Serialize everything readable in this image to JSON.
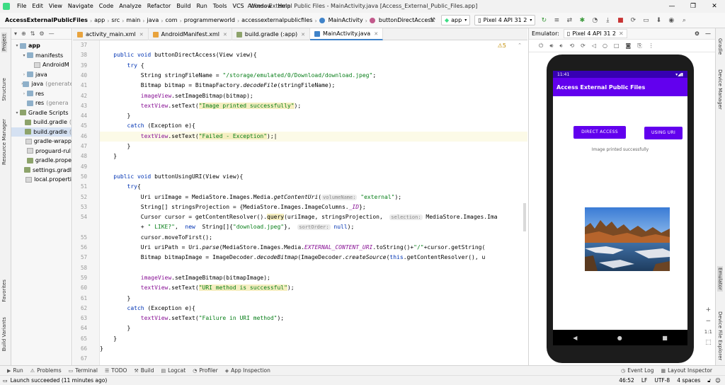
{
  "window": {
    "title": "Access External Public Files - MainActivity.java [Access_External_Public_Files.app]"
  },
  "menu": [
    "File",
    "Edit",
    "View",
    "Navigate",
    "Code",
    "Analyze",
    "Refactor",
    "Build",
    "Run",
    "Tools",
    "VCS",
    "Window",
    "Help"
  ],
  "breadcrumbs": [
    "AccessExternalPublicFiles",
    "app",
    "src",
    "main",
    "java",
    "com",
    "programmerworld",
    "accessexternalpublicfiles",
    "MainActivity",
    "buttonDirectAccess"
  ],
  "toolbar": {
    "config": "app",
    "device": "Pixel 4 API 31 2"
  },
  "left_tabs": [
    "Project",
    "Structure",
    "Resource Manager",
    "Favorites",
    "Build Variants"
  ],
  "right_tabs": [
    "Gradle",
    "Device Manager",
    "Emulator",
    "Device File Explorer"
  ],
  "project_tree": [
    {
      "label": "app",
      "level": 0,
      "arrow": "▾",
      "icon": "folder",
      "bold": true
    },
    {
      "label": "manifests",
      "level": 1,
      "arrow": "▾",
      "icon": "folder"
    },
    {
      "label": "AndroidM",
      "level": 2,
      "arrow": "",
      "icon": "file"
    },
    {
      "label": "java",
      "level": 1,
      "arrow": "›",
      "icon": "folder"
    },
    {
      "label": "java",
      "suffix": "(generate",
      "level": 1,
      "arrow": "›",
      "icon": "folder"
    },
    {
      "label": "res",
      "level": 1,
      "arrow": "›",
      "icon": "folder"
    },
    {
      "label": "res",
      "suffix": "(genera",
      "level": 1,
      "arrow": "",
      "icon": "folder"
    },
    {
      "label": "Gradle Scripts",
      "level": 0,
      "arrow": "▾",
      "icon": "gradle"
    },
    {
      "label": "build.gradle",
      "suffix": "(",
      "level": 1,
      "arrow": "",
      "icon": "gradle"
    },
    {
      "label": "build.gradle",
      "suffix": "(",
      "level": 1,
      "arrow": "",
      "icon": "gradle",
      "selected": true
    },
    {
      "label": "gradle-wrapp",
      "level": 1,
      "arrow": "",
      "icon": "file"
    },
    {
      "label": "proguard-rul",
      "level": 1,
      "arrow": "",
      "icon": "file"
    },
    {
      "label": "gradle.prope",
      "level": 1,
      "arrow": "",
      "icon": "gradle"
    },
    {
      "label": "settings.gradl",
      "level": 1,
      "arrow": "",
      "icon": "gradle"
    },
    {
      "label": "local.properti",
      "level": 1,
      "arrow": "",
      "icon": "file"
    }
  ],
  "tabs": [
    {
      "label": "activity_main.xml",
      "color": "#e8a33d"
    },
    {
      "label": "AndroidManifest.xml",
      "color": "#e8a33d"
    },
    {
      "label": "build.gradle (:app)",
      "color": "#8da36b"
    },
    {
      "label": "MainActivity.java",
      "color": "#4083c9",
      "active": true
    }
  ],
  "editor": {
    "warnings": "⚠5",
    "line_numbers": [
      "37",
      "38",
      "39",
      "40",
      "41",
      "42",
      "43",
      "44",
      "45",
      "46",
      "47",
      "48",
      "49",
      "50",
      "51",
      "52",
      "53",
      "54",
      "",
      "55",
      "56",
      "57",
      "58",
      "59",
      "60",
      "61",
      "62",
      "63",
      "64",
      "65",
      "66",
      "67"
    ],
    "lines": [
      [],
      [
        {
          "t": "    "
        },
        {
          "t": "public void ",
          "c": "kw"
        },
        {
          "t": "buttonDirectAccess(View view){"
        }
      ],
      [
        {
          "t": "        "
        },
        {
          "t": "try ",
          "c": "kw"
        },
        {
          "t": "{"
        }
      ],
      [
        {
          "t": "            String stringFileName = "
        },
        {
          "t": "\"/storage/emulated/0/Download/download.jpeg\"",
          "c": "str"
        },
        {
          "t": ";"
        }
      ],
      [
        {
          "t": "            Bitmap bitmap = BitmapFactory."
        },
        {
          "t": "decodeFile",
          "c": "it"
        },
        {
          "t": "(stringFileName);"
        }
      ],
      [
        {
          "t": "            "
        },
        {
          "t": "imageView",
          "c": "fld"
        },
        {
          "t": ".setImageBitmap(bitmap);"
        }
      ],
      [
        {
          "t": "            "
        },
        {
          "t": "textView",
          "c": "fld"
        },
        {
          "t": ".setText("
        },
        {
          "t": "\"Image printed successfully\"",
          "c": "str hl"
        },
        {
          "t": ");"
        }
      ],
      [
        {
          "t": "        }"
        }
      ],
      [
        {
          "t": "        "
        },
        {
          "t": "catch ",
          "c": "kw"
        },
        {
          "t": "(Exception e){"
        }
      ],
      [
        {
          "t": "            "
        },
        {
          "t": "textView",
          "c": "fld"
        },
        {
          "t": ".setText("
        },
        {
          "t": "\"Failed - Exception\"",
          "c": "str hl"
        },
        {
          "t": ");|"
        }
      ],
      [
        {
          "t": "        }"
        }
      ],
      [
        {
          "t": "    }"
        }
      ],
      [],
      [
        {
          "t": "    "
        },
        {
          "t": "public void ",
          "c": "kw"
        },
        {
          "t": "buttonUsingURI(View view){"
        }
      ],
      [
        {
          "t": "        "
        },
        {
          "t": "try",
          "c": "kw"
        },
        {
          "t": "{"
        }
      ],
      [
        {
          "t": "            Uri uriImage = MediaStore.Images.Media."
        },
        {
          "t": "getContentUri",
          "c": "it"
        },
        {
          "t": "("
        },
        {
          "t": "volumeName:",
          "c": "hint"
        },
        {
          "t": " "
        },
        {
          "t": "\"external\"",
          "c": "str"
        },
        {
          "t": ");"
        }
      ],
      [
        {
          "t": "            String[] stringsProjection = {MediaStore.Images.ImageColumns."
        },
        {
          "t": "_ID",
          "c": "fld it"
        },
        {
          "t": "};"
        }
      ],
      [
        {
          "t": "            Cursor cursor = getContentResolver()."
        },
        {
          "t": "query",
          "c": "hl"
        },
        {
          "t": "(uriImage, stringsProjection,  "
        },
        {
          "t": "selection:",
          "c": "hint"
        },
        {
          "t": " MediaStore.Images.Ima"
        }
      ],
      [
        {
          "t": "            + "
        },
        {
          "t": "\" LIKE?\"",
          "c": "str"
        },
        {
          "t": ",  "
        },
        {
          "t": "new  ",
          "c": "kw"
        },
        {
          "t": "String[]{"
        },
        {
          "t": "\"download.jpeg\"",
          "c": "str"
        },
        {
          "t": "},  "
        },
        {
          "t": "sortOrder:",
          "c": "hint"
        },
        {
          "t": " "
        },
        {
          "t": "null",
          "c": "kw"
        },
        {
          "t": ");"
        }
      ],
      [
        {
          "t": "            cursor.moveToFirst();"
        }
      ],
      [
        {
          "t": "            Uri uriPath = Uri."
        },
        {
          "t": "parse",
          "c": "it"
        },
        {
          "t": "(MediaStore.Images.Media."
        },
        {
          "t": "EXTERNAL_CONTENT_URI",
          "c": "fld it"
        },
        {
          "t": ".toString()+"
        },
        {
          "t": "\"/\"",
          "c": "str"
        },
        {
          "t": "+cursor.getString("
        }
      ],
      [
        {
          "t": "            Bitmap bitmapImage = ImageDecoder."
        },
        {
          "t": "decodeBitmap",
          "c": "it"
        },
        {
          "t": "(ImageDecoder."
        },
        {
          "t": "createSource",
          "c": "it"
        },
        {
          "t": "("
        },
        {
          "t": "this",
          "c": "kw"
        },
        {
          "t": ".getContentResolver(), u"
        }
      ],
      [],
      [
        {
          "t": "            "
        },
        {
          "t": "imageView",
          "c": "fld"
        },
        {
          "t": ".setImageBitmap(bitmapImage);"
        }
      ],
      [
        {
          "t": "            "
        },
        {
          "t": "textView",
          "c": "fld"
        },
        {
          "t": ".setText("
        },
        {
          "t": "\"URI method is successful\"",
          "c": "str hl"
        },
        {
          "t": ");"
        }
      ],
      [
        {
          "t": "        }"
        }
      ],
      [
        {
          "t": "        "
        },
        {
          "t": "catch ",
          "c": "kw"
        },
        {
          "t": "(Exception e){"
        }
      ],
      [
        {
          "t": "            "
        },
        {
          "t": "textView",
          "c": "fld"
        },
        {
          "t": ".setText("
        },
        {
          "t": "\"Failure in URI method\"",
          "c": "str"
        },
        {
          "t": ");"
        }
      ],
      [
        {
          "t": "        }"
        }
      ],
      [
        {
          "t": "    }"
        }
      ],
      [
        {
          "t": "}"
        }
      ],
      []
    ]
  },
  "emulator": {
    "header_label": "Emulator:",
    "device": "Pixel 4 API 31 2"
  },
  "phone": {
    "time": "11:41",
    "app_title": "Access External Public Files",
    "btn_direct": "DIRECT ACCESS",
    "btn_uri": "USING URI",
    "status_text": "Image printed successfully",
    "nav": [
      "◀",
      "●",
      "■"
    ]
  },
  "zoom": [
    "+",
    "−",
    "1:1",
    "⬚"
  ],
  "bottom_tools": [
    {
      "icon": "▶",
      "label": "Run"
    },
    {
      "icon": "⚠",
      "label": "Problems"
    },
    {
      "icon": "▭",
      "label": "Terminal"
    },
    {
      "icon": "☰",
      "label": "TODO"
    },
    {
      "icon": "⚒",
      "label": "Build"
    },
    {
      "icon": "▤",
      "label": "Logcat"
    },
    {
      "icon": "◔",
      "label": "Profiler"
    },
    {
      "icon": "◈",
      "label": "App Inspection"
    }
  ],
  "bottom_right": [
    {
      "icon": "◷",
      "label": "Event Log"
    },
    {
      "icon": "▦",
      "label": "Layout Inspector"
    }
  ],
  "status": {
    "message": "Launch succeeded (11 minutes ago)",
    "position": "46:52",
    "line_sep": "LF",
    "encoding": "UTF-8",
    "indent": "4 spaces"
  }
}
